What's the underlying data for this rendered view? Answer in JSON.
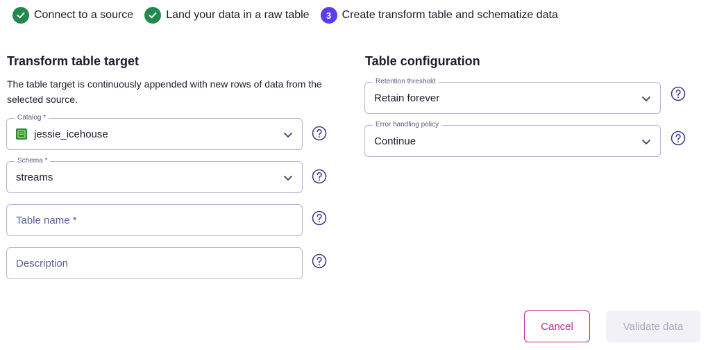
{
  "stepper": {
    "steps": [
      {
        "label": "Connect to a source",
        "state": "done"
      },
      {
        "label": "Land your data in a raw table",
        "state": "done"
      },
      {
        "label": "Create transform table and schematize data",
        "state": "active",
        "number": "3"
      }
    ]
  },
  "left": {
    "title": "Transform table target",
    "description": "The table target is continuously appended with new rows of data from the selected source.",
    "catalog": {
      "legend": "Catalog *",
      "value": "jessie_icehouse",
      "icon": "database-icon"
    },
    "schema": {
      "legend": "Schema *",
      "value": "streams"
    },
    "table_name": {
      "placeholder": "Table name *"
    },
    "description_field": {
      "placeholder": "Description"
    }
  },
  "right": {
    "title": "Table configuration",
    "retention": {
      "legend": "Retention threshold",
      "value": "Retain forever"
    },
    "error_policy": {
      "legend": "Error handling policy",
      "value": "Continue"
    }
  },
  "actions": {
    "cancel_label": "Cancel",
    "validate_label": "Validate data"
  },
  "colors": {
    "accent": "#5b3cf0",
    "success": "#1f8a4c",
    "cancel": "#c1288f",
    "border": "#b6b3d6"
  }
}
